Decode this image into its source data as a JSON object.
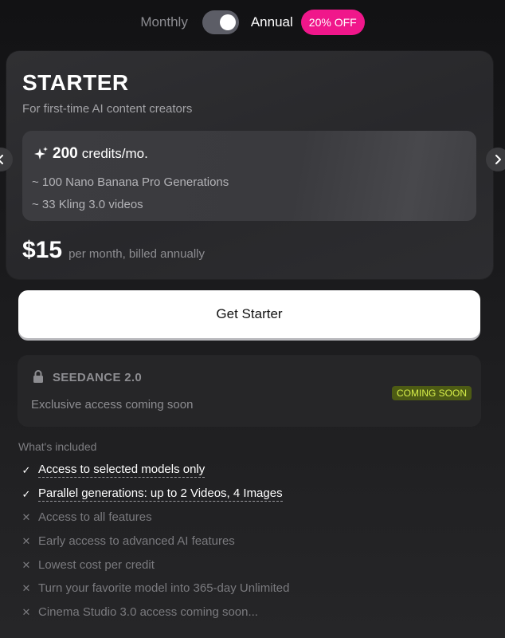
{
  "billing": {
    "monthly_label": "Monthly",
    "annual_label": "Annual",
    "discount_badge": "20% OFF",
    "annual_selected": true
  },
  "plan": {
    "name": "STARTER",
    "subtitle": "For first-time AI content creators",
    "credits_amount": "200",
    "credits_unit": "credits/mo.",
    "credit_lines": [
      "~ 100 Nano Banana Pro Generations",
      "~ 33 Kling 3.0 videos"
    ],
    "price": "$15",
    "price_note": "per month, billed annually"
  },
  "cta": {
    "label": "Get Starter"
  },
  "seedance": {
    "title": "SEEDANCE 2.0",
    "subtitle": "Exclusive access coming soon",
    "badge": "COMING SOON"
  },
  "included": {
    "title": "What's included",
    "items": [
      {
        "label": "Access to selected models only",
        "included": true
      },
      {
        "label": "Parallel generations: up to 2 Videos, 4 Images",
        "included": true
      },
      {
        "label": "Access to all features",
        "included": false
      },
      {
        "label": "Early access to advanced AI features",
        "included": false
      },
      {
        "label": "Lowest cost per credit",
        "included": false
      },
      {
        "label": "Turn your favorite model into 365-day Unlimited",
        "included": false
      },
      {
        "label": "Cinema Studio 3.0 access coming soon...",
        "included": false
      }
    ]
  },
  "colors": {
    "accent_pink": "#f0178b",
    "coming_soon_text": "#d7ef4a",
    "coming_soon_bg": "#4d5b14"
  }
}
